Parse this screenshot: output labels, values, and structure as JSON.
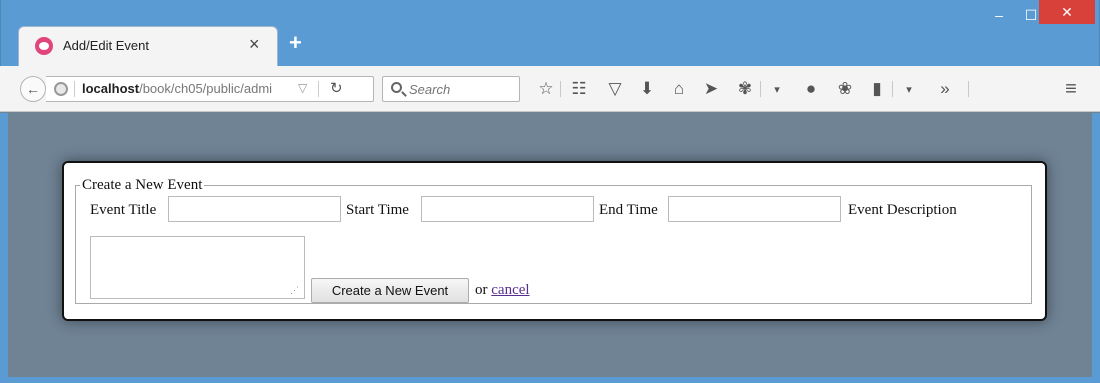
{
  "browser": {
    "tab_title": "Add/Edit Event",
    "tab_close": "×",
    "new_tab": "+",
    "url_host": "localhost",
    "url_path": "/book/ch05/public/admi",
    "search_placeholder": "Search",
    "window_min": "‒",
    "window_max": "☐",
    "window_close": "✕",
    "overflow": "»",
    "menu": "≡"
  },
  "form": {
    "legend": "Create a New Event",
    "event_title_label": "Event Title",
    "event_title_value": "",
    "start_time_label": "Start Time",
    "start_time_value": "",
    "end_time_label": "End Time",
    "end_time_value": "",
    "description_label": "Event Description",
    "description_value": "",
    "submit_label": "Create a New Event",
    "or_text": "or",
    "cancel_label": "cancel"
  }
}
